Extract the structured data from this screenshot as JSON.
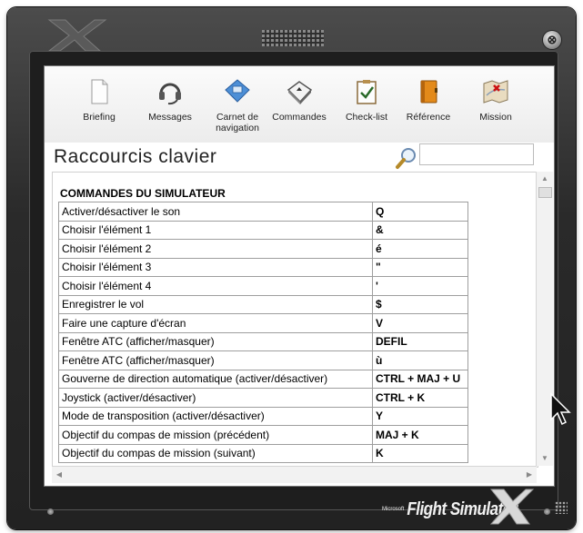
{
  "toolbar": {
    "items": [
      {
        "label": "Briefing",
        "icon": "document-icon"
      },
      {
        "label": "Messages",
        "icon": "headset-icon"
      },
      {
        "label": "Carnet de navigation",
        "icon": "logbook-icon"
      },
      {
        "label": "Commandes",
        "icon": "keyboard-icon"
      },
      {
        "label": "Check-list",
        "icon": "checklist-icon"
      },
      {
        "label": "Référence",
        "icon": "reference-book-icon"
      },
      {
        "label": "Mission",
        "icon": "mission-map-icon"
      }
    ]
  },
  "page": {
    "heading": "Raccourcis clavier",
    "search_value": ""
  },
  "section": {
    "title": "COMMANDES DU SIMULATEUR"
  },
  "shortcuts": [
    {
      "command": "Activer/désactiver le son",
      "key": "Q"
    },
    {
      "command": "Choisir l'élément 1",
      "key": "&"
    },
    {
      "command": "Choisir l'élément 2",
      "key": "é"
    },
    {
      "command": "Choisir l'élément 3",
      "key": "\""
    },
    {
      "command": "Choisir l'élément 4",
      "key": "'"
    },
    {
      "command": "Enregistrer le vol",
      "key": "$"
    },
    {
      "command": "Faire une capture d'écran",
      "key": "V"
    },
    {
      "command": "Fenêtre ATC (afficher/masquer)",
      "key": "DEFIL"
    },
    {
      "command": "Fenêtre ATC (afficher/masquer)",
      "key": "ù"
    },
    {
      "command": "Gouverne de direction automatique (activer/désactiver)",
      "key": "CTRL + MAJ + U"
    },
    {
      "command": "Joystick (activer/désactiver)",
      "key": "CTRL + K"
    },
    {
      "command": "Mode de transposition (activer/désactiver)",
      "key": "Y"
    },
    {
      "command": "Objectif du compas de mission (précédent)",
      "key": "MAJ + K"
    },
    {
      "command": "Objectif du compas de mission (suivant)",
      "key": "K"
    }
  ],
  "brand": {
    "microsoft": "Microsoft",
    "product": "Flight Simulator"
  },
  "window": {
    "close_glyph": "⊗"
  },
  "colors": {
    "frame": "#2a2a2a",
    "panel": "#ffffff",
    "table_border": "#9e9e9e"
  }
}
